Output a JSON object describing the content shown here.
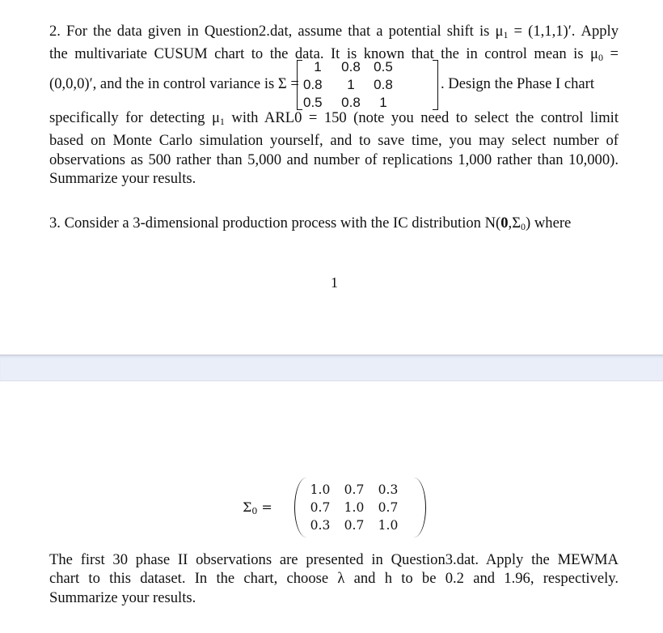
{
  "document": {
    "page1": {
      "q2": {
        "line1": [
          "2. For the data given in Question2.dat, assume that a potential shift is μ",
          "1",
          " = (1,1,1)′. Apply"
        ],
        "line2": [
          "the multivariate CUSUM chart to the data. It is known that the in control mean is μ",
          "0",
          " ="
        ],
        "line3_pre": "(0,0,0)′, and the in control variance is Σ =",
        "line3_post": ". Design the Phase I chart",
        "sigma_matrix": [
          [
            "1",
            "0.8",
            "0.5"
          ],
          [
            "0.8",
            "1",
            "0.8"
          ],
          [
            "0.5",
            "0.8",
            "1"
          ]
        ],
        "line4": [
          "specifically for detecting μ",
          "1",
          " with ARL0 = 150 (note you need to select the control limit"
        ],
        "line5": "based on Monte Carlo simulation yourself, and to save time, you may select number of",
        "line6": "observations as 500 rather than 5,000 and number of replications 1,000 rather than 10,000).",
        "line7": "Summarize your results."
      },
      "q3": {
        "intro": [
          "3. Consider a 3-dimensional production process with the IC distribution N(",
          "0",
          ",Σ",
          "0",
          ") where"
        ]
      },
      "page_number": "1"
    },
    "page2": {
      "sigma0_label": [
        "Σ",
        "0",
        " ="
      ],
      "sigma0_matrix": [
        [
          "1.0",
          "0.7",
          "0.3"
        ],
        [
          "0.7",
          "1.0",
          "0.7"
        ],
        [
          "0.3",
          "0.7",
          "1.0"
        ]
      ],
      "text": {
        "line1": "The first 30 phase II observations are presented in Question3.dat. Apply the MEWMA",
        "line2": "chart to this dataset. In the chart, choose λ and h to be 0.2 and 1.96, respectively.",
        "line3": "Summarize your results."
      }
    },
    "colors": {
      "page_gap": "#e9eef9",
      "text": "#111111"
    }
  }
}
